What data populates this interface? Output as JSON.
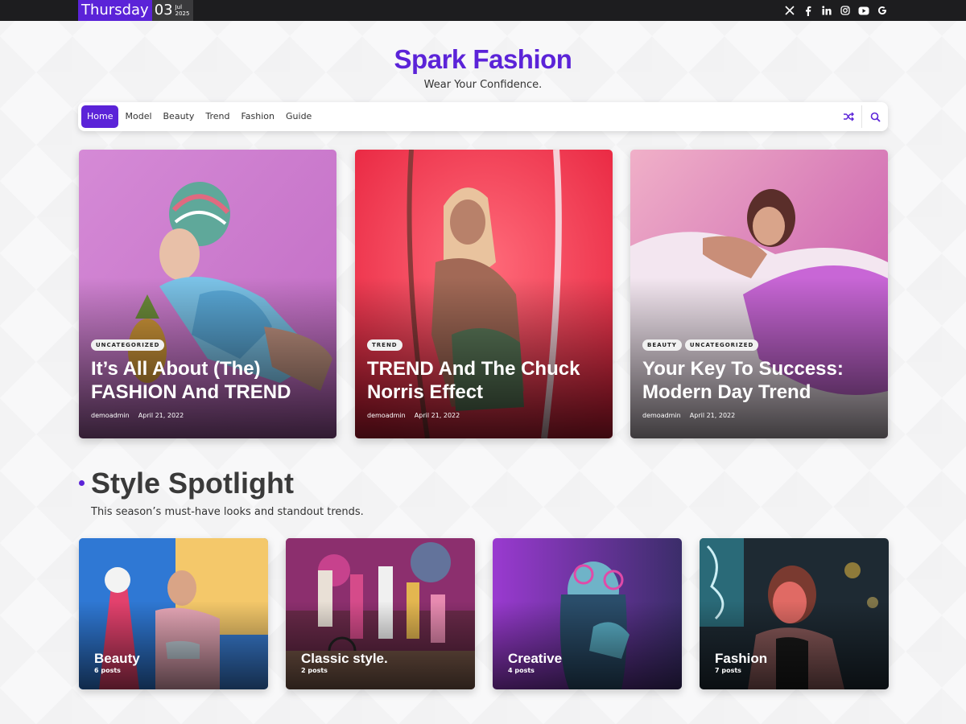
{
  "topbar": {
    "day": "Thursday",
    "date_num": "03",
    "month": "Jul",
    "year": "2025",
    "social": [
      {
        "icon": "x-icon",
        "glyph": "𝕏"
      },
      {
        "icon": "facebook-icon",
        "glyph": "f"
      },
      {
        "icon": "linkedin-icon",
        "glyph": "in"
      },
      {
        "icon": "instagram-icon",
        "glyph": ""
      },
      {
        "icon": "youtube-icon",
        "glyph": ""
      },
      {
        "icon": "google-icon",
        "glyph": "G"
      }
    ]
  },
  "header": {
    "title": "Spark Fashion",
    "tagline": "Wear Your Confidence."
  },
  "nav": {
    "items": [
      "Home",
      "Model",
      "Beauty",
      "Trend",
      "Fashion",
      "Guide"
    ],
    "active": "Home",
    "right_icons": [
      "shuffle-icon",
      "search-icon"
    ]
  },
  "hero": [
    {
      "tags": [
        "UNCATEGORIZED"
      ],
      "title": "It’s All About (The) FASHION And TREND",
      "author": "demoadmin",
      "date": "April 21, 2022"
    },
    {
      "tags": [
        "TREND"
      ],
      "title": "TREND And The Chuck Norris Effect",
      "author": "demoadmin",
      "date": "April 21, 2022"
    },
    {
      "tags": [
        "BEAUTY",
        "UNCATEGORIZED"
      ],
      "title": "Your Key To Success: Modern Day Trend",
      "author": "demoadmin",
      "date": "April 21, 2022"
    }
  ],
  "section": {
    "title": "Style Spotlight",
    "subtitle": "This season’s must-have looks and standout trends."
  },
  "categories": [
    {
      "name": "Beauty",
      "count": "6 posts"
    },
    {
      "name": "Classic style.",
      "count": "2 posts"
    },
    {
      "name": "Creative",
      "count": "4 posts"
    },
    {
      "name": "Fashion",
      "count": "7 posts"
    }
  ],
  "colors": {
    "accent": "#5b23d8",
    "topbar": "#1d1d1f"
  }
}
